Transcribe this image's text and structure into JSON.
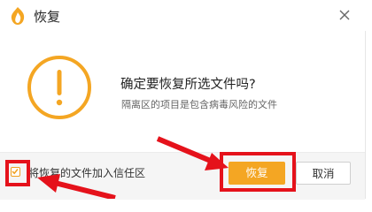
{
  "title": "恢复",
  "dialog": {
    "message": "确定要恢复所选文件吗?",
    "subtext": "隔离区的项目是包含病毒风险的文件"
  },
  "footer": {
    "checkbox_label": "将恢复的文件加入信任区",
    "checkbox_checked": true,
    "restore_label": "恢复",
    "cancel_label": "取消"
  },
  "colors": {
    "accent": "#f4a623",
    "annotation": "#e5121b"
  },
  "icons": {
    "app": "flame-shield-icon",
    "close": "close-icon",
    "warning": "exclamation-circle-icon"
  }
}
